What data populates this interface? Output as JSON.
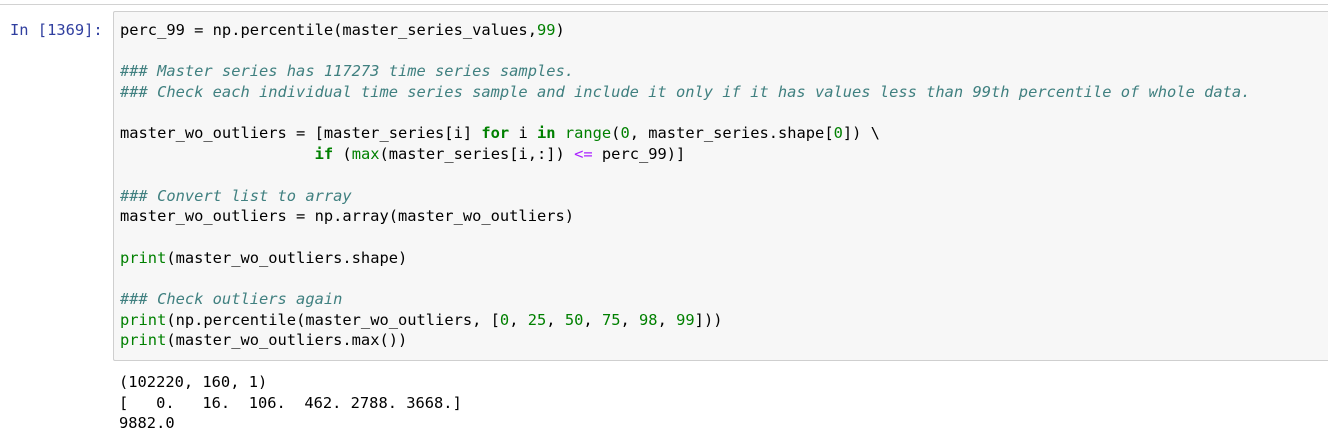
{
  "cell": {
    "prompt": "In [1369]:",
    "code": {
      "l1": {
        "a": "perc_99 = np.percentile(master_series_values,",
        "b": "99",
        "c": ")"
      },
      "l3": "### Master series has 117273 time series samples.",
      "l4": "### Check each individual time series sample and include it only if it has values less than 99th percentile of whole data.",
      "l6": {
        "a": "master_wo_outliers = [master_series[i] ",
        "kw_for": "for",
        "b": " i ",
        "kw_in": "in",
        "c": " ",
        "fn_range": "range",
        "d": "(",
        "n0": "0",
        "e": ", master_series.shape[",
        "n0b": "0",
        "f": "]) \\"
      },
      "l7": {
        "indent": "                     ",
        "kw_if": "if",
        "a": " (",
        "fn_max": "max",
        "b": "(master_series[i,:]) ",
        "op": "<=",
        "c": " perc_99)]"
      },
      "l9": "### Convert list to array",
      "l10": "master_wo_outliers = np.array(master_wo_outliers)",
      "l12": {
        "fn_print": "print",
        "a": "(master_wo_outliers.shape)"
      },
      "l14": "### Check outliers again",
      "l15": {
        "fn_print": "print",
        "a": "(np.percentile(master_wo_outliers, [",
        "n1": "0",
        "s1": ", ",
        "n2": "25",
        "s2": ", ",
        "n3": "50",
        "s3": ", ",
        "n4": "75",
        "s4": ", ",
        "n5": "98",
        "s5": ", ",
        "n6": "99",
        "b": "]))"
      },
      "l16": {
        "fn_print": "print",
        "a": "(master_wo_outliers.max())"
      }
    },
    "output": {
      "line1": "(102220, 160, 1)",
      "line2": "[   0.   16.  106.  462. 2788. 3668.]",
      "line3": "9882.0"
    }
  },
  "colors": {
    "prompt": "#303f9f",
    "comment": "#408080",
    "keyword": "#008000",
    "number": "#008000",
    "operator": "#aa22ff",
    "cell_background": "#f7f7f7",
    "cell_border": "#cfcfcf"
  }
}
